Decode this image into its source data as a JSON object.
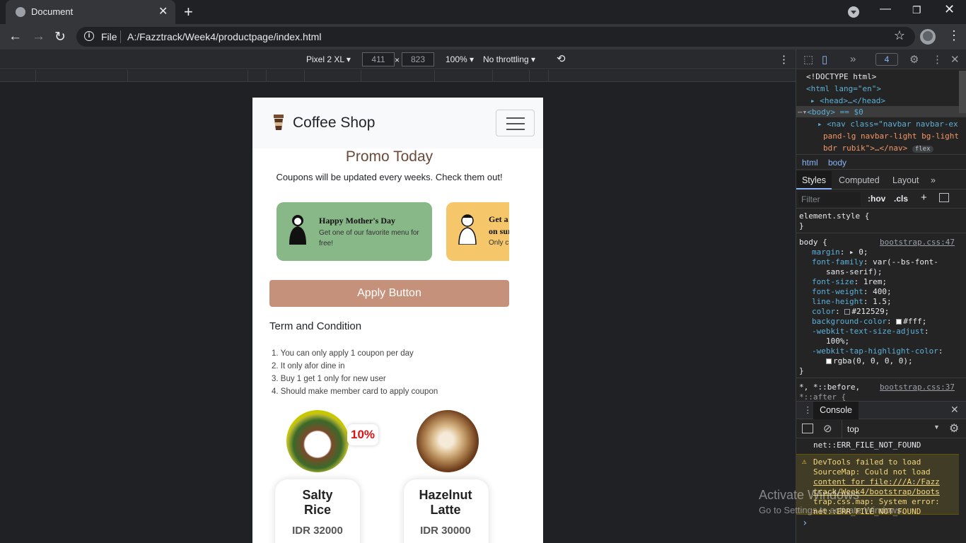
{
  "browser": {
    "tab_title": "Document",
    "tab_close": "✕",
    "new_tab": "+",
    "window_controls": {
      "minimize": "—",
      "maximize": "❐",
      "close": "✕"
    },
    "toolbar": {
      "back": "←",
      "forward": "→",
      "reload": "↻"
    },
    "omnibox": {
      "info": "i",
      "scheme": "File",
      "url": "A:/Fazztrack/Week4/productpage/index.html",
      "star": "☆"
    },
    "menu": "⋮"
  },
  "device_toolbar": {
    "device": "Pixel 2 XL ▾",
    "width": "411",
    "times": "×",
    "height": "823",
    "zoom": "100% ▾",
    "throttling": "No throttling ▾",
    "rotate": "⟲",
    "more": "⋮"
  },
  "page": {
    "brand": "Coffee Shop",
    "promo_title": "Promo Today",
    "promo_subtitle": "Coupons will be updated every weeks. Check them out!",
    "coupons": [
      {
        "title": "Happy Mother's Day",
        "desc": "Get one of our favorite menu for free!",
        "color": "#88b788"
      },
      {
        "title": "Get a",
        "title2": "on sur",
        "desc": "Only c",
        "color": "#f5c76a"
      }
    ],
    "apply_button": "Apply Button",
    "terms_title": "Term and Condition",
    "terms": [
      "1. You can only apply 1 coupon per day",
      "2. It only afor dine in",
      "3. Buy 1 get 1 only for new user",
      "4. Should make member card to apply coupon"
    ],
    "products": [
      {
        "name_line1": "Salty",
        "name_line2": "Rice",
        "price": "IDR 32000",
        "discount": "10%"
      },
      {
        "name_line1": "Hazelnut",
        "name_line2": "Latte",
        "price": "IDR 30000"
      }
    ]
  },
  "devtools": {
    "top_more": "»",
    "badge": "4",
    "dom": {
      "doctype": "<!DOCTYPE html>",
      "html_open": "<html lang=\"en\">",
      "head": "<head>…</head>",
      "body": "<body> == $0",
      "nav1": "<nav class=\"navbar navbar-ex",
      "nav2": "pand-lg navbar-light bg-light",
      "nav3": "bdr rubik\">…</nav>",
      "nav_badge": "flex"
    },
    "crumbs": [
      "html",
      "body"
    ],
    "tabs": {
      "styles": "Styles",
      "computed": "Computed",
      "layout": "Layout",
      "more": "»"
    },
    "filter": {
      "placeholder": "Filter",
      "hov": ":hov",
      "cls": ".cls",
      "plus": "+"
    },
    "styles": {
      "element_style": "element.style {",
      "close1": "}",
      "body_selector": "body {",
      "body_source": "bootstrap.css:47",
      "props": [
        {
          "name": "margin",
          "value": "▸ 0;"
        },
        {
          "name": "font-family",
          "value": "var(--bs-font-"
        },
        {
          "name": "",
          "value": "sans-serif);"
        },
        {
          "name": "font-size",
          "value": "1rem;"
        },
        {
          "name": "font-weight",
          "value": "400;"
        },
        {
          "name": "line-height",
          "value": "1.5;"
        },
        {
          "name": "color",
          "value": "#212529;"
        },
        {
          "name": "background-color",
          "value": "#fff;"
        },
        {
          "name": "-webkit-text-size-adjust",
          "value": ""
        },
        {
          "name": "",
          "value": "100%;"
        },
        {
          "name": "-webkit-tap-highlight-color",
          "value": ""
        },
        {
          "name": "",
          "value": "rgba(0, 0, 0, 0);"
        }
      ],
      "close2": "}",
      "universal": "*, *::before,",
      "universal_source": "bootstrap.css:37",
      "after": "*::after {"
    },
    "console": {
      "tab": "Console",
      "context": "top",
      "err_top": "net::ERR_FILE_NOT_FOUND",
      "warn_lines": [
        "DevTools failed to load",
        "SourceMap: Could not load",
        "content for file:///A:/Fazz",
        "track/Week4/bootstrap/boots",
        "trap.css.map: System error:",
        "net::ERR_FILE_NOT_FOUND"
      ],
      "prompt": "›"
    }
  },
  "os_watermark": {
    "line1": "Activate Windows",
    "line2": "Go to Settings to activate Windows."
  }
}
